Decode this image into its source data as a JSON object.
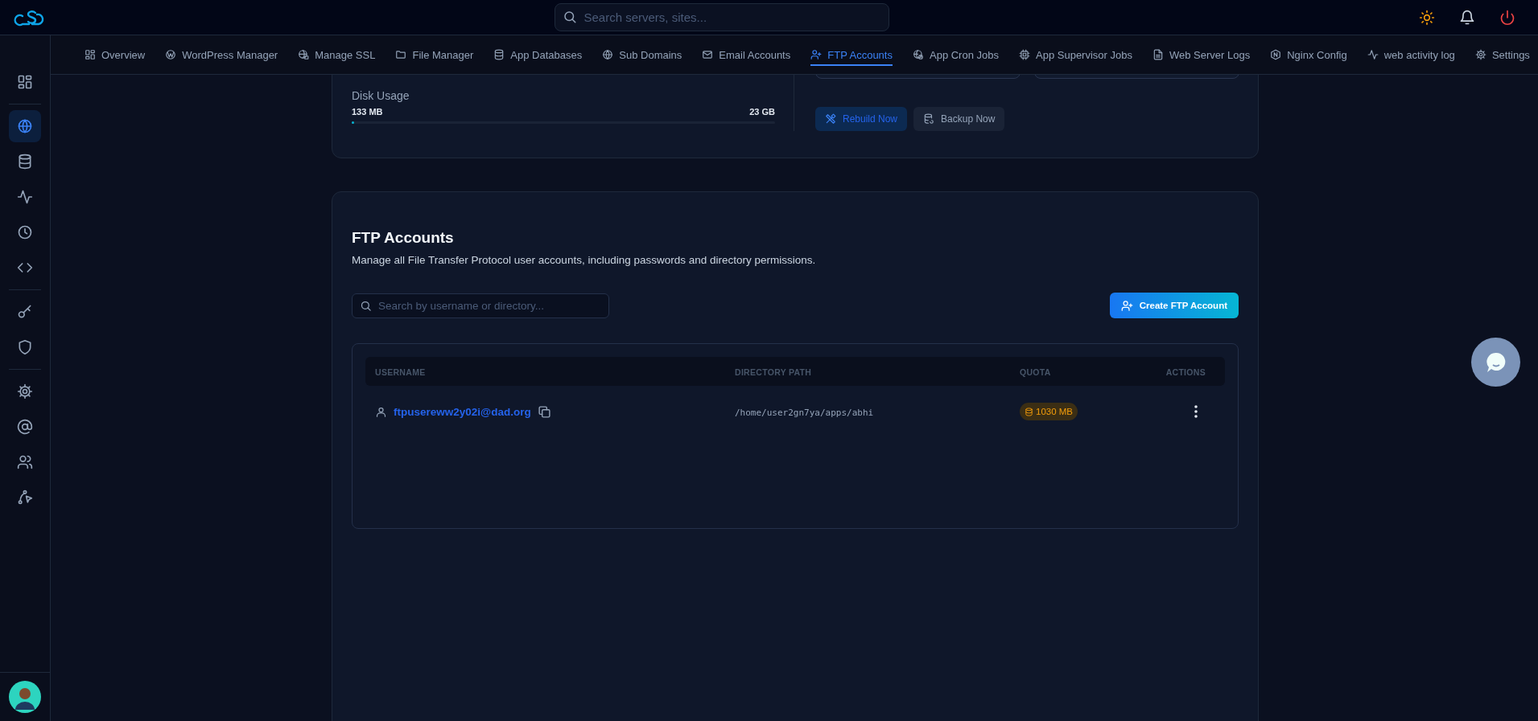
{
  "topbar": {
    "search": {
      "placeholder": "Search servers, sites..."
    }
  },
  "sidebar": {
    "items": [
      {
        "selected": false
      },
      {
        "selected": true
      },
      {
        "selected": false
      },
      {
        "selected": false
      },
      {
        "selected": false
      },
      {
        "selected": false
      },
      {
        "selected": false
      },
      {
        "selected": false
      },
      {
        "selected": false
      },
      {
        "selected": false
      },
      {
        "selected": false
      },
      {
        "selected": false
      }
    ]
  },
  "tabs": [
    {
      "label": "Overview",
      "selected": false
    },
    {
      "label": "WordPress Manager",
      "selected": false
    },
    {
      "label": "Manage SSL",
      "selected": false
    },
    {
      "label": "File Manager",
      "selected": false
    },
    {
      "label": "App Databases",
      "selected": false
    },
    {
      "label": "Sub Domains",
      "selected": false
    },
    {
      "label": "Email Accounts",
      "selected": false
    },
    {
      "label": "FTP Accounts",
      "selected": true
    },
    {
      "label": "App Cron Jobs",
      "selected": false
    },
    {
      "label": "App Supervisor Jobs",
      "selected": false
    },
    {
      "label": "Web Server Logs",
      "selected": false
    },
    {
      "label": "Nginx Config",
      "selected": false
    },
    {
      "label": "web activity log",
      "selected": false
    },
    {
      "label": "Settings",
      "selected": false
    }
  ],
  "disk_usage": {
    "label": "Disk Usage",
    "used": "133 MB",
    "total": "23 GB",
    "level": 0.006
  },
  "actions": [
    {
      "label": "Rebuild Now",
      "kind": "primary"
    },
    {
      "label": "Backup Now",
      "kind": "secondary"
    }
  ],
  "ftp": {
    "title": "FTP Accounts",
    "description": "Manage all File Transfer Protocol user accounts, including passwords and directory permissions.",
    "search": {
      "placeholder": "Search by username or directory..."
    },
    "create_button": "Create FTP Account",
    "table": {
      "columns": [
        "USERNAME",
        "DIRECTORY PATH",
        "QUOTA",
        "ACTIONS"
      ],
      "rows": [
        {
          "username": "ftpusereww2y02i@dad.org",
          "directory": "/home/user2gn7ya/apps/abhi",
          "quota": "1030 MB"
        }
      ]
    }
  }
}
